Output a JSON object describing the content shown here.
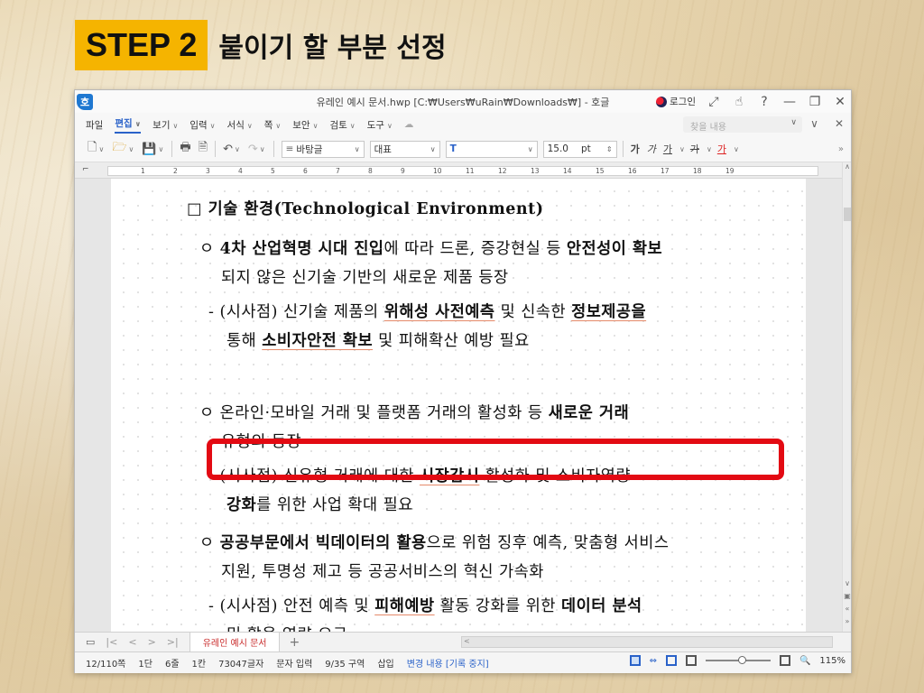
{
  "slide": {
    "step_badge": "STEP 2",
    "heading": "붙이기 할 부분 선정"
  },
  "window": {
    "logo": "호",
    "title": "유레인 예시 문서.hwp [C:₩Users₩uRain₩Downloads₩] - 호글",
    "login_label": "로그인",
    "title_icons": [
      "expand-icon",
      "gesture-icon",
      "help-icon",
      "minimize-icon",
      "restore-icon",
      "close-icon"
    ]
  },
  "menu": {
    "items": [
      "파일",
      "편집",
      "보기",
      "입력",
      "서식",
      "쪽",
      "보안",
      "검토",
      "도구"
    ],
    "active": "편집",
    "find_placeholder": "찾을 내용"
  },
  "toolbar": {
    "style_value": "바탕글",
    "font_value": "대표",
    "font_name_value": "",
    "size_value": "15.0",
    "size_unit": "pt",
    "format_buttons": [
      "가",
      "가",
      "가",
      "가",
      "가"
    ]
  },
  "ruler": {
    "ticks": [
      "1",
      "2",
      "3",
      "4",
      "5",
      "6",
      "7",
      "8",
      "9",
      "10",
      "11",
      "12",
      "13",
      "14",
      "15",
      "16",
      "17",
      "18",
      "19"
    ]
  },
  "document": {
    "heading": "□ 기술 환경(Technological Environment)",
    "p1_l1": [
      "ㅇ ",
      "4차 산업혁명 시대 진입",
      "에 따라 드론, 증강현실 등 ",
      "안전성이 확보"
    ],
    "p1_l2": "되지 않은 신기술 기반의 새로운 제품 등장",
    "p2_l1": [
      "- (시사점) 신기술 제품의 ",
      "위해성 사전예측",
      " 및 신속한 ",
      "정보제공을"
    ],
    "p2_l2": [
      "통해 ",
      "소비자안전 확보",
      " 및 피해확산 예방 필요"
    ],
    "p3_l1": [
      "ㅇ 온라인·모바일 거래 및 플랫폼 거래의 활성화 등 ",
      "새로운 거래"
    ],
    "p3_l2": "유형의 등장",
    "p4_l1": [
      "- (시사점) 신유형 거래에 대한 ",
      "시장감시",
      " 활성화 및 소비자역량"
    ],
    "p4_l2": [
      "강화",
      "를 위한 사업 확대 필요"
    ],
    "p5_l1": [
      "ㅇ ",
      "공공부문에서 빅데이터의 활용",
      "으로 위험 징후 예측, 맞춤형 서비스"
    ],
    "p5_l2": "지원, 투명성 제고 등 공공서비스의 혁신 가속화",
    "p6_l1": [
      "- (시사점) 안전 예측 및 ",
      "피해예방",
      " 활동 강화를 위한 ",
      "데이터 분석"
    ],
    "p6_l2": "및 활용 역량 요구"
  },
  "tabs": {
    "doc_tab": "유레인 예시 문서",
    "add": "+"
  },
  "status": {
    "page": "12/110쪽",
    "column": "1단",
    "line": "6줄",
    "col": "1칸",
    "chars": "73047글자",
    "mode": "문자 입력",
    "section": "9/35 구역",
    "insert": "삽입",
    "track_changes": "변경 내용 [기록 중지]",
    "zoom": "115%"
  }
}
